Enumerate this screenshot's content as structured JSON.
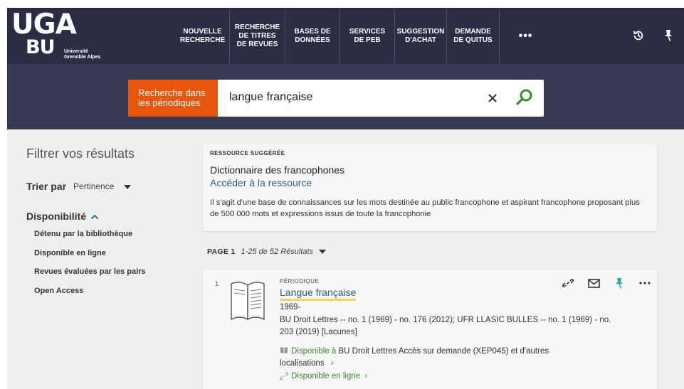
{
  "logo": {
    "line1": "UGA",
    "line2": "BU",
    "subtitle_1": "Université",
    "subtitle_2": "Grenoble Alpes"
  },
  "nav": {
    "items": [
      {
        "label": "NOUVELLE RECHERCHE"
      },
      {
        "label": "RECHERCHE DE TITRES DE REVUES"
      },
      {
        "label": "BASES DE DONNÉES"
      },
      {
        "label": "SERVICES DE PEB"
      },
      {
        "label": "SUGGESTION D'ACHAT"
      },
      {
        "label": "DEMANDE DE QUITUS"
      },
      {
        "label": "•••"
      }
    ],
    "icons": [
      "history-icon",
      "pin-icon"
    ]
  },
  "search": {
    "scope_label": "Recherche dans les périodiques",
    "query": "langue française"
  },
  "filters": {
    "title": "Filtrer vos résultats",
    "sort_label": "Trier par",
    "sort_value": "Pertinence",
    "availability_label": "Disponibilité",
    "facets": [
      "Détenu par la bibliothèque",
      "Disponible en ligne",
      "Revues évaluées par les pairs",
      "Open Access"
    ]
  },
  "suggested": {
    "kicker": "RESSOURCE SUGGÉRÉE",
    "title": "Dictionnaire des francophones",
    "link": "Accéder à la ressource",
    "description": "Il s'agit d'une base de connaissances sur les mots destinée au public francophone et aspirant francophone proposant plus de 500 000 mots et expressions issus de toute la francophonie"
  },
  "pagination": {
    "page_label": "PAGE 1",
    "count": "1-25 de 52 Résultats"
  },
  "results": [
    {
      "number": "1",
      "type": "PÉRIODIQUE",
      "title": "Langue française",
      "year": "1969-",
      "holdings": "BU Droit Lettres -- no. 1 (1969) - no. 176 (2012); UFR LLASIC BULLES -- no. 1 (1969) - no. 203 (2019) [Lacunes]",
      "availability_prefix": "Disponible à",
      "availability_rest": "BU Droit Lettres  Accès sur demande (XEP045) et d'autres localisations",
      "online": "Disponible en ligne"
    }
  ],
  "colors": {
    "nav_bg": "#2a2d43",
    "search_band": "#363a53",
    "scope_orange": "#e8550e",
    "link_blue": "#2a5f8a",
    "available_green": "#3a8b2e",
    "highlight_yellow": "#f4d35e",
    "pin_teal": "#2aa6b8"
  }
}
